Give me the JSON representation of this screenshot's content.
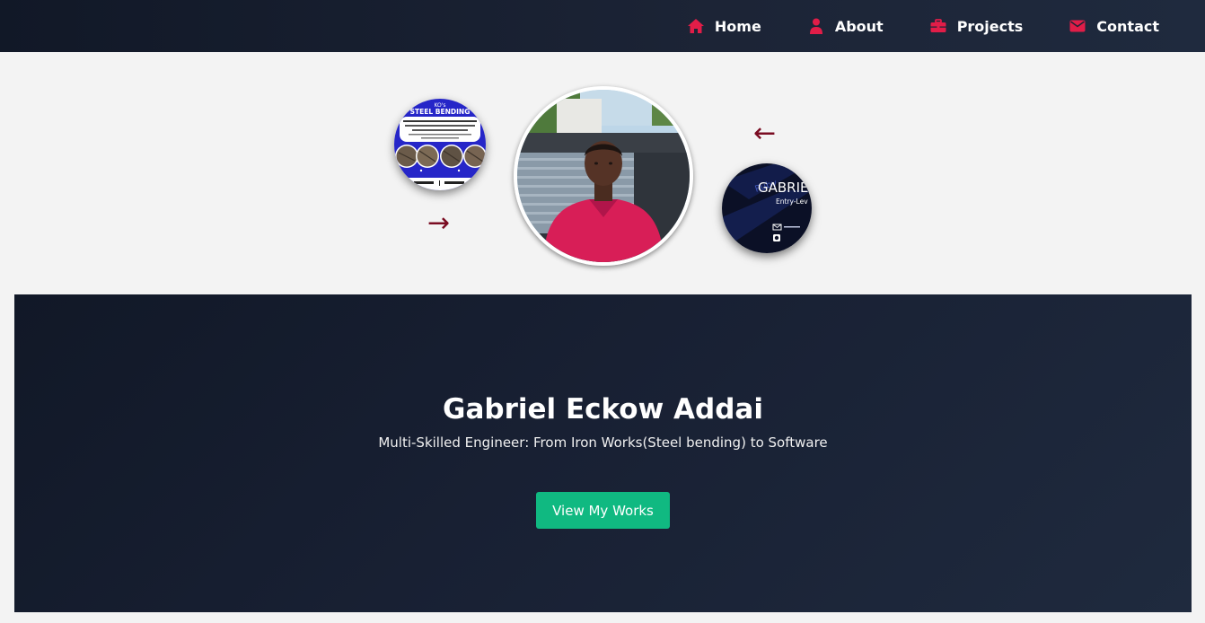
{
  "nav": {
    "items": [
      {
        "label": "Home",
        "icon": "home-icon"
      },
      {
        "label": "About",
        "icon": "user-icon"
      },
      {
        "label": "Projects",
        "icon": "briefcase-icon"
      },
      {
        "label": "Contact",
        "icon": "envelope-icon"
      }
    ],
    "icon_color": "#e11d48"
  },
  "carousel": {
    "next_arrow": "→",
    "prev_arrow": "←",
    "left_thumb_lettering": "STEEL BENDING",
    "right_thumb_lettering": [
      "GABRIE",
      "Entry-Lev"
    ],
    "arrow_color": "#7a0c22"
  },
  "hero": {
    "name": "Gabriel Eckow Addai",
    "tagline": "Multi-Skilled Engineer: From Iron Works(Steel bending) to Software",
    "button_label": "View My Works",
    "button_color": "#10b981"
  }
}
